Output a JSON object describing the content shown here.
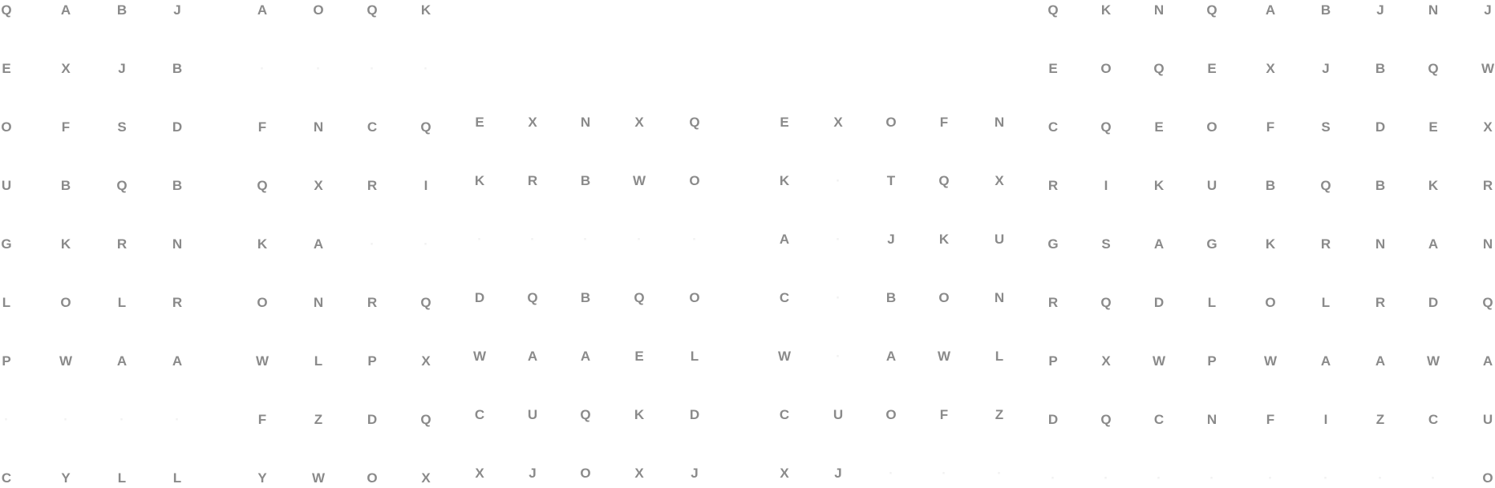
{
  "text_color": "#8a8a8a",
  "faint_color": "#f2f2f2",
  "blocks": [
    {
      "name": "left-block",
      "rows": [
        [
          "Q",
          "A",
          "B",
          "J"
        ],
        [
          "E",
          "X",
          "J",
          "B"
        ],
        [
          "O",
          "F",
          "S",
          "D"
        ],
        [
          "U",
          "B",
          "Q",
          "B"
        ],
        [
          "G",
          "K",
          "R",
          "N"
        ],
        [
          "L",
          "O",
          "L",
          "R"
        ],
        [
          "P",
          "W",
          "A",
          "A"
        ],
        [
          "",
          "",
          "",
          ""
        ],
        [
          "C",
          "Y",
          "L",
          "L"
        ]
      ]
    },
    {
      "name": "center-left-block",
      "rows": [
        [
          "A",
          "O",
          "Q",
          "K"
        ],
        [
          "",
          "",
          "",
          ""
        ],
        [
          "F",
          "N",
          "C",
          "Q"
        ],
        [
          "Q",
          "X",
          "R",
          "I"
        ],
        [
          "K",
          "A",
          "",
          ""
        ],
        [
          "O",
          "N",
          "R",
          "Q"
        ],
        [
          "W",
          "L",
          "P",
          "X"
        ],
        [
          "F",
          "Z",
          "D",
          "Q"
        ],
        [
          "Y",
          "W",
          "O",
          "X"
        ]
      ]
    },
    {
      "name": "center-block",
      "rows": [
        [
          "E",
          "X",
          "N",
          "X",
          "Q"
        ],
        [
          "K",
          "R",
          "B",
          "W",
          "O"
        ],
        [
          "",
          "",
          "",
          "",
          ""
        ],
        [
          "D",
          "Q",
          "B",
          "Q",
          "O"
        ],
        [
          "W",
          "A",
          "A",
          "E",
          "L"
        ],
        [
          "C",
          "U",
          "Q",
          "K",
          "D"
        ],
        [
          "X",
          "J",
          "O",
          "X",
          "J"
        ]
      ]
    },
    {
      "name": "center-right-block",
      "rows": [
        [
          "E",
          "X",
          "O",
          "F",
          "N"
        ],
        [
          "K",
          "",
          "T",
          "Q",
          "X"
        ],
        [
          "A",
          "",
          "J",
          "K",
          "U"
        ],
        [
          "C",
          "",
          "B",
          "O",
          "N"
        ],
        [
          "W",
          "",
          "A",
          "W",
          "L"
        ],
        [
          "C",
          "U",
          "O",
          "F",
          "Z"
        ],
        [
          "X",
          "J",
          "",
          "",
          ""
        ]
      ]
    },
    {
      "name": "right-block",
      "rows": [
        [
          "Q",
          "K",
          "N",
          "Q",
          "A",
          "B",
          "J",
          "N",
          "J"
        ],
        [
          "E",
          "O",
          "Q",
          "E",
          "X",
          "J",
          "B",
          "Q",
          "W"
        ],
        [
          "C",
          "Q",
          "E",
          "O",
          "F",
          "S",
          "D",
          "E",
          "X"
        ],
        [
          "R",
          "I",
          "K",
          "U",
          "B",
          "Q",
          "B",
          "K",
          "R"
        ],
        [
          "G",
          "S",
          "A",
          "G",
          "K",
          "R",
          "N",
          "A",
          "N"
        ],
        [
          "R",
          "Q",
          "D",
          "L",
          "O",
          "L",
          "R",
          "D",
          "Q"
        ],
        [
          "P",
          "X",
          "W",
          "P",
          "W",
          "A",
          "A",
          "W",
          "A"
        ],
        [
          "D",
          "Q",
          "C",
          "N",
          "F",
          "I",
          "Z",
          "C",
          "U"
        ],
        [
          "",
          "",
          "",
          "",
          "",
          "",
          "",
          "",
          "O"
        ]
      ]
    }
  ]
}
